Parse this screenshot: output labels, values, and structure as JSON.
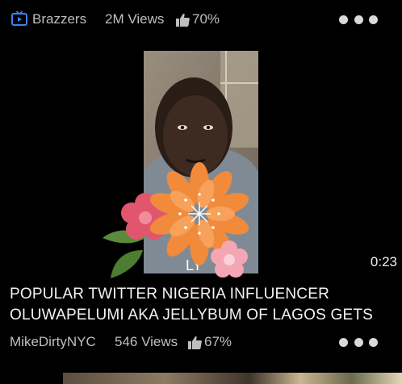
{
  "top_video": {
    "channel": "Brazzers",
    "views": "2M Views",
    "rating": "70%",
    "channel_icon": "tv-play-icon"
  },
  "main_video": {
    "overlay_text": "LY",
    "duration": "0:23",
    "title_lines": [
      "POPULAR TWITTER NIGERIA INFLUENCER",
      "OLUWAPELUMI AKA JELLYBUM OF LAGOS GETS"
    ],
    "uploader": "MikeDirtyNYC",
    "views": "546 Views",
    "rating": "67%"
  },
  "colors": {
    "background": "#000000",
    "meta_text": "#bfbfbf",
    "title_text": "#f3f3f3",
    "accent_icon": "#3b82f6"
  }
}
